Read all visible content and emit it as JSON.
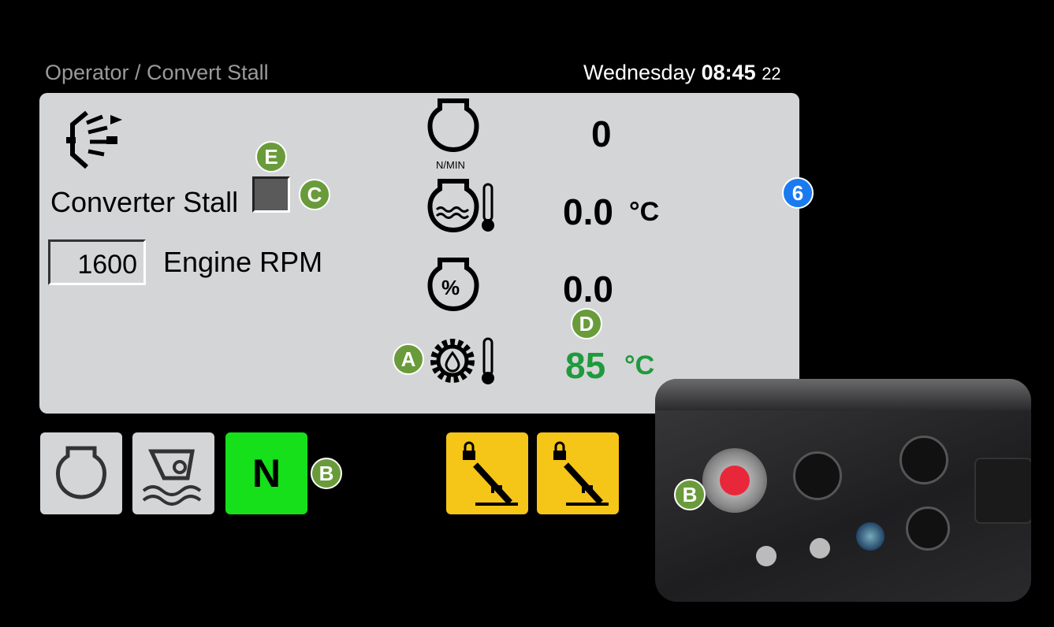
{
  "header": {
    "breadcrumb": "Operator / Convert Stall",
    "day": "Wednesday",
    "time": "08:45",
    "seconds": "22"
  },
  "left": {
    "converter_stall_label": "Converter Stall",
    "engine_rpm_value": "1600",
    "engine_rpm_label": "Engine RPM"
  },
  "gauges": {
    "engine_speed_unit": "N/MIN",
    "engine_speed_value": "0",
    "coolant_temp_value": "0.0",
    "coolant_temp_unit": "°C",
    "engine_load_value": "0.0",
    "engine_load_icon_text": "%",
    "trans_oil_temp_value": "85",
    "trans_oil_temp_unit": "°C"
  },
  "buttons": {
    "neutral_label": "N"
  },
  "badges": {
    "a": "A",
    "b": "B",
    "c": "C",
    "d": "D",
    "e": "E",
    "six": "6",
    "b2": "B"
  },
  "colors": {
    "panel": "#d4d5d7",
    "green_value": "#1f9a3d",
    "neutral_btn": "#15e01a",
    "yellow_btn": "#f5c518",
    "badge_green": "#6a9b3b",
    "badge_blue": "#1a7bf0"
  },
  "icons": [
    "converter-stall-icon",
    "engine-icon",
    "coolant-temp-icon",
    "engine-load-icon",
    "transmission-oil-temp-icon",
    "engine-button-icon",
    "brake-hand-icon",
    "park-lock-pedal-icon",
    "emergency-stop-icon"
  ]
}
